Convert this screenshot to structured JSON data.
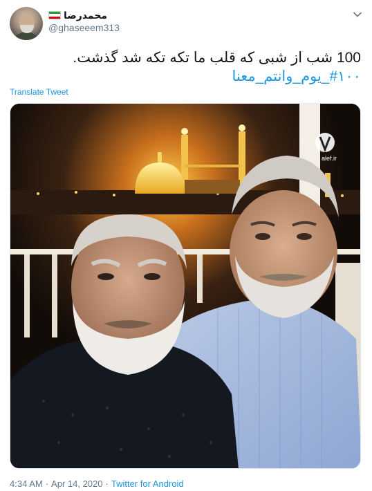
{
  "user": {
    "display_name": "محمدرضا",
    "handle": "@ghaseeem313",
    "flag_colors": [
      "#239f40",
      "#ffffff",
      "#da0000"
    ]
  },
  "tweet": {
    "text": "100 شب از شبی که قلب ما تکه تکه شد گذشت.",
    "hashtag": "#۱۰۰_یوم_وانتم_معنا",
    "translate_label": "Translate Tweet",
    "photo_watermark": "alef.ir"
  },
  "meta": {
    "time": "4:34 AM",
    "separator1": "·",
    "date": "Apr 14, 2020",
    "separator2": "·",
    "source": "Twitter for Android"
  },
  "colors": {
    "link": "#1b95e0",
    "secondary_text": "#657786",
    "primary_text": "#14171a"
  }
}
